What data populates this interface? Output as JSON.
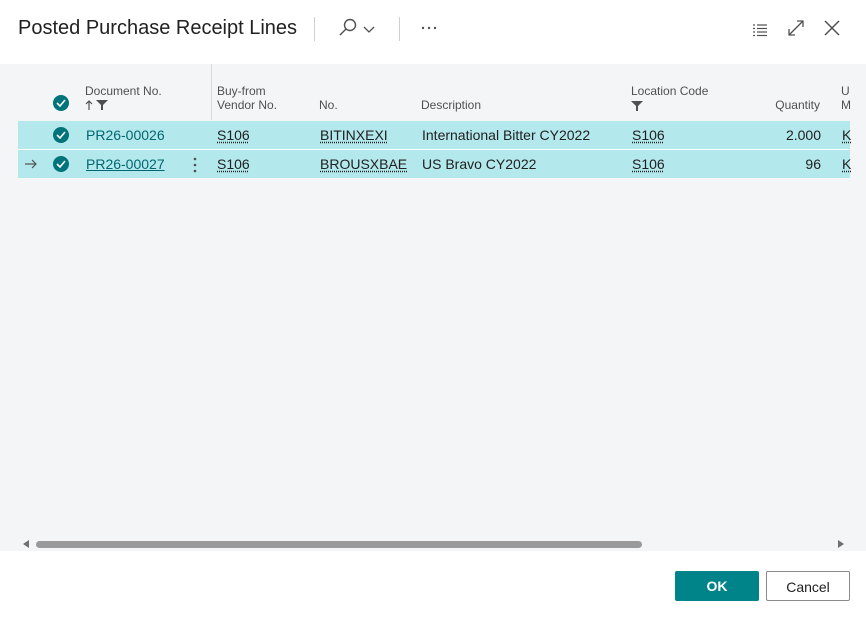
{
  "window": {
    "title": "Posted Purchase Receipt Lines",
    "search_icon": "search-icon",
    "more_icon": "ellipsis-icon",
    "list_icon": "list-view-icon",
    "expand_icon": "expand-icon",
    "close_icon": "close-icon"
  },
  "columns": {
    "document_no": "Document No.",
    "buy_from_line1": "Buy-from",
    "buy_from_line2": "Vendor No.",
    "no": "No.",
    "description": "Description",
    "location_code": "Location Code",
    "quantity": "Quantity",
    "uom_line1": "U",
    "uom_line2": "M"
  },
  "rows": [
    {
      "document_no": "PR26-00026",
      "vendor_no": "S106",
      "no": "BITINXEXI",
      "description": "International Bitter CY2022",
      "location_code": "S106",
      "quantity": "2.000",
      "uom": "K"
    },
    {
      "document_no": "PR26-00027",
      "vendor_no": "S106",
      "no": "BROUSXBAE",
      "description": "US Bravo CY2022",
      "location_code": "S106",
      "quantity": "96",
      "uom": "K"
    }
  ],
  "footer": {
    "ok_label": "OK",
    "cancel_label": "Cancel"
  },
  "colors": {
    "accent": "#00848a",
    "row_selected": "#b3e8ec",
    "link": "#00686e"
  }
}
